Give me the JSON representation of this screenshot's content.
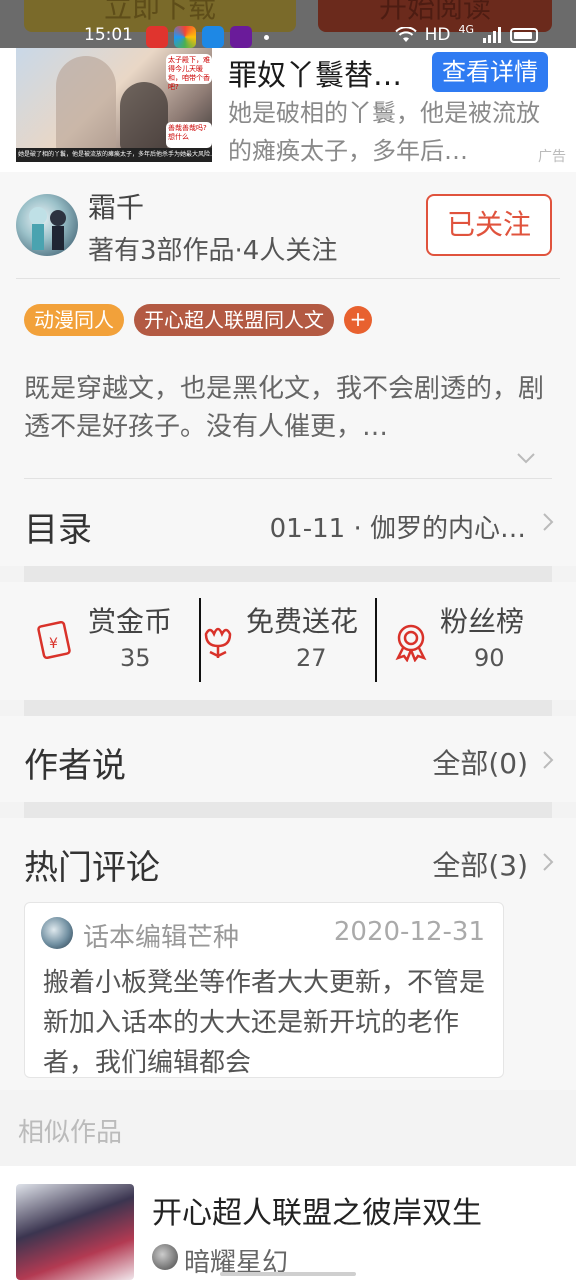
{
  "status_bar": {
    "time": "15:01",
    "network": "HD",
    "signal_label": "4G",
    "app_icons": [
      "app-red-icon",
      "app-colorful-icon",
      "app-blue-icon",
      "app-purple-icon"
    ]
  },
  "top_actions": {
    "left_button": "立即下载",
    "right_button": "开始阅读"
  },
  "ad": {
    "title": "罪奴丫鬟替…",
    "detail_button": "查看详情",
    "description": "她是破相的丫鬟，他是被流放的瘫痪太子，多年后…",
    "label": "广告",
    "thumb_bubble_top": "太子殿下，难得今儿天暖和，咱带个香吧?",
    "thumb_bubble_bottom": "善哉善哉吗?想什么",
    "thumb_caption": "她是破了相的丫鬟，他是被流放的瘫痪太子，多年后他杀手为她最大风险…"
  },
  "author": {
    "name": "霜千",
    "meta": "著有3部作品·4人关注",
    "follow_button": "已关注"
  },
  "tags": [
    "动漫同人",
    "开心超人联盟同人文"
  ],
  "tag_add": "+",
  "description": "既是穿越文，也是黑化文，我不会剧透的，剧透不是好孩子。没有人催更，…",
  "toc": {
    "title": "目录",
    "latest": "01-11 · 伽罗的内心…"
  },
  "stats": [
    {
      "label": "赏金币",
      "value": "35",
      "icon": "red-envelope-icon"
    },
    {
      "label": "免费送花",
      "value": "27",
      "icon": "flower-icon"
    },
    {
      "label": "粉丝榜",
      "value": "90",
      "icon": "medal-icon"
    }
  ],
  "author_says": {
    "title": "作者说",
    "link": "全部(0)"
  },
  "hot_comments": {
    "title": "热门评论",
    "link": "全部(3)",
    "items": [
      {
        "user": "话本编辑芒种",
        "date": "2020-12-31",
        "text": "搬着小板凳坐等作者大大更新，不管是新加入话本的大大还是新开坑的老作者，我们编辑都会"
      }
    ]
  },
  "similar": {
    "label": "相似作品",
    "items": [
      {
        "title": "开心超人联盟之彼岸双生",
        "author": "暗耀星幻"
      }
    ]
  },
  "colors": {
    "accent_red": "#e0533d",
    "ad_button_blue": "#2f7bf2",
    "tag_orange": "#f2a13a",
    "tag_brown": "#b35a43"
  }
}
